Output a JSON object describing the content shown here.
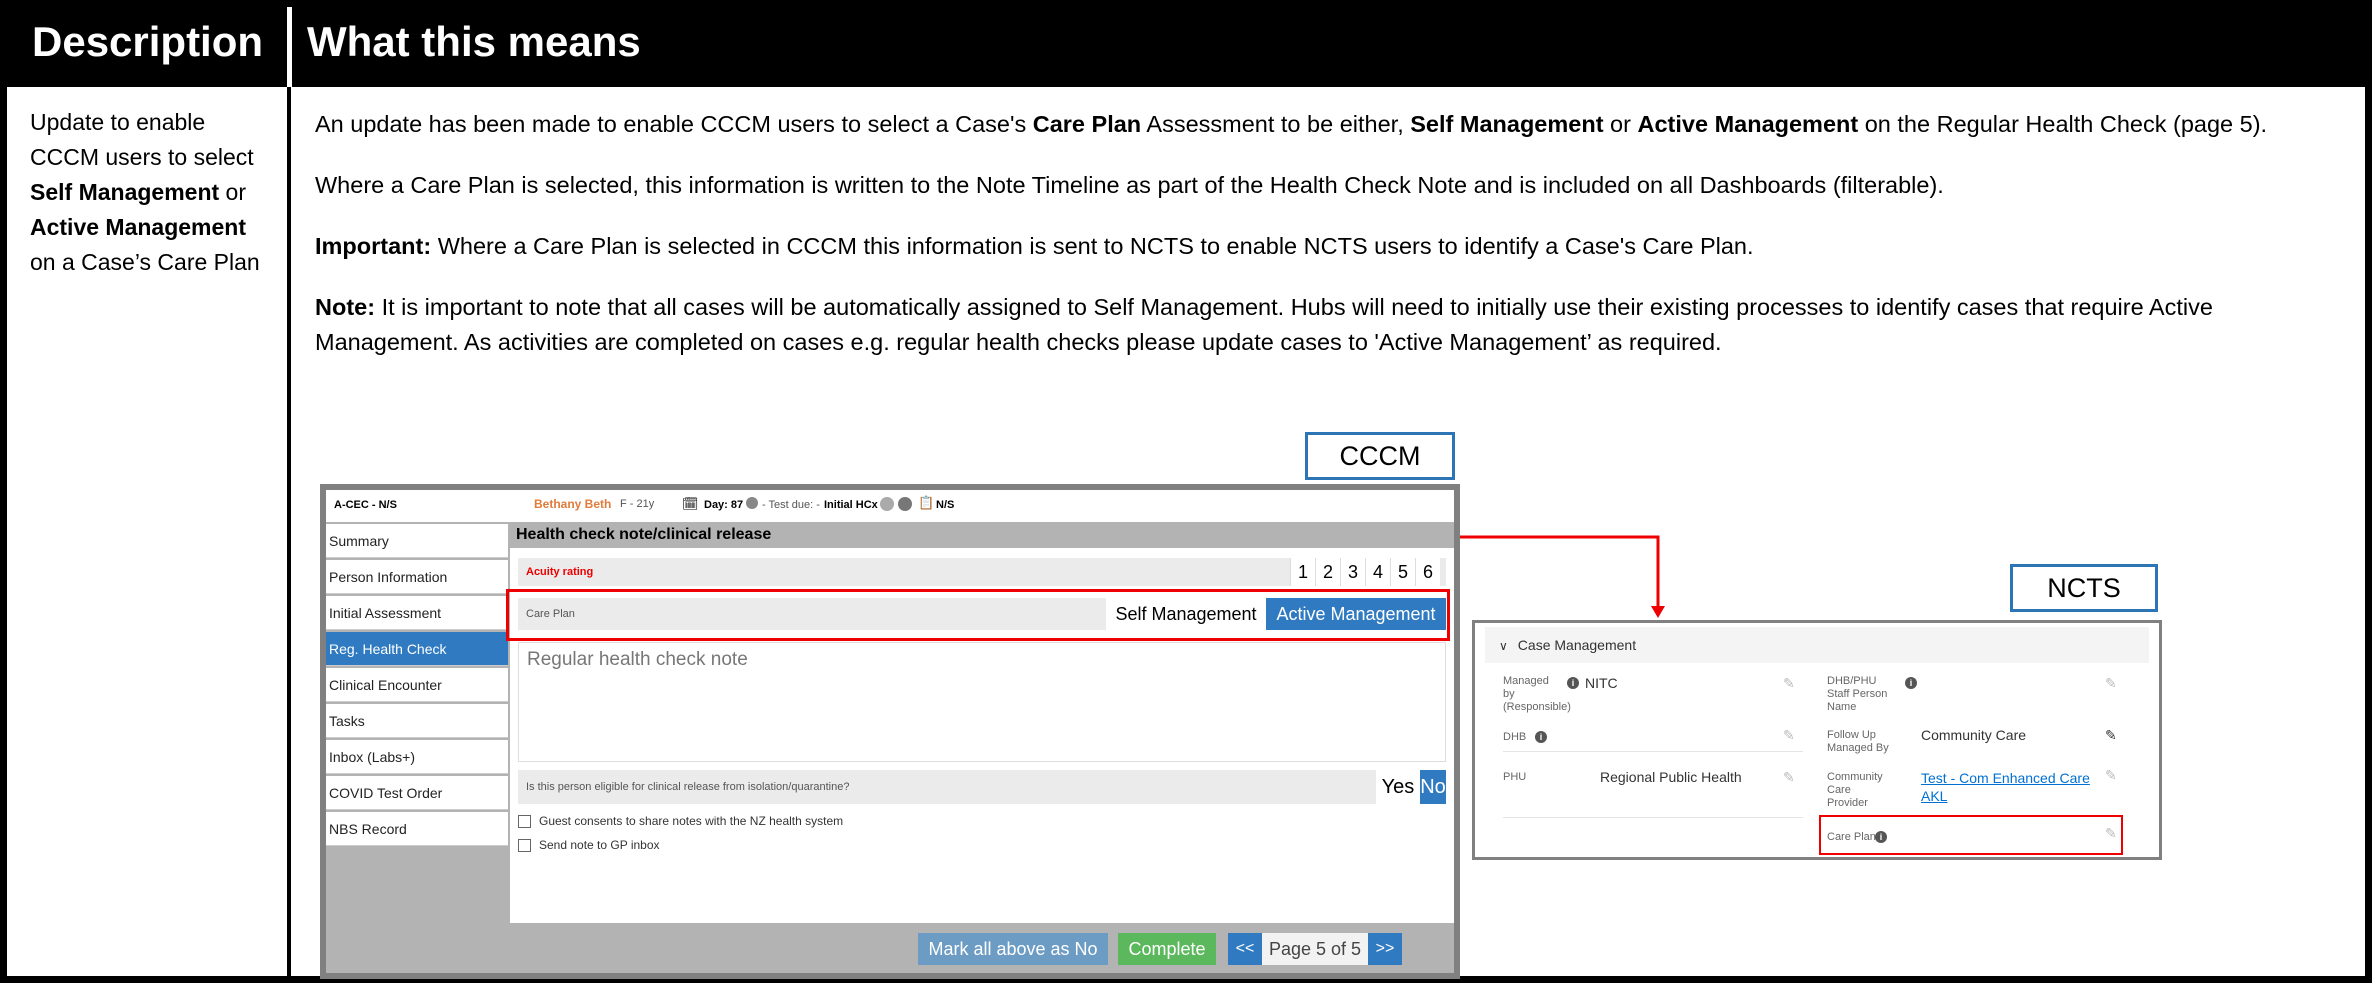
{
  "header": {
    "description": "Description",
    "meaning": "What this means"
  },
  "description_cell": {
    "p1": "Update to enable CCCM users to select ",
    "b1": "Self Management",
    "p2": " or ",
    "b2": "Active Management",
    "p3": " on a Case’s Care Plan"
  },
  "meaning": {
    "para1": {
      "t1": "An update has been made to enable CCCM users to select a Case's ",
      "b1": "Care Plan",
      "t2": " Assessment to be either, ",
      "b2": "Self Management",
      "t3": " or ",
      "b3": "Active Management",
      "t4": " on the Regular Health Check (page 5)."
    },
    "para2": "Where a Care Plan is selected, this information is written to the Note Timeline as part of the Health Check Note and is included on all Dashboards (filterable).",
    "para3": {
      "b": "Important:",
      "t": " Where a Care Plan is selected in CCCM this information is sent to NCTS to enable NCTS users to identify a Case's Care Plan."
    },
    "para4": {
      "b": "Note:",
      "t": " It is important to note that all cases will be automatically assigned to Self Management. Hubs will need to initially use their existing processes to identify cases that require Active Management. As activities are completed on cases e.g. regular health checks please update cases to 'Active Management’ as required."
    }
  },
  "labels": {
    "cccm": "CCCM",
    "ncts": "NCTS"
  },
  "cccm": {
    "case_id": "A-CEC - N/S",
    "patient_name": "Bethany Beth",
    "patient_meta": "F - 21y",
    "day": "Day: 87",
    "test_due": "- Test due: -",
    "initial_hcx": "Initial HCx",
    "ns": "N/S",
    "nav": [
      "Summary",
      "Person Information",
      "Initial Assessment",
      "Reg. Health Check",
      "Clinical Encounter",
      "Tasks",
      "Inbox (Labs+)",
      "COVID Test Order",
      "NBS Record"
    ],
    "active_nav": "Reg. Health Check",
    "section_title": "Health check note/clinical release",
    "acuity_label": "Acuity rating",
    "acuity_values": [
      "1",
      "2",
      "3",
      "4",
      "5",
      "6"
    ],
    "care_plan_label": "Care Plan",
    "self_mgmt": "Self Management",
    "active_mgmt": "Active Management",
    "note_placeholder": "Regular health check note",
    "eligibility_question": "Is this person eligible for clinical release from isolation/quarantine?",
    "yes": "Yes",
    "no": "No",
    "consent": "Guest consents to share notes with the NZ health system",
    "send_gp": "Send note to GP inbox",
    "mark_all": "Mark all above as No",
    "complete": "Complete",
    "prev": "<<",
    "page": "Page 5 of 5",
    "next": ">>",
    "colors": {
      "active": "#2f7ac0",
      "complete": "#5cb85c",
      "mark": "#6c9cc4",
      "highlight": "#e00000",
      "name": "#e07b39"
    }
  },
  "ncts": {
    "section": "Case Management",
    "managed_by_label": "Managed by (Responsible)",
    "managed_by_value": "NITC",
    "dhb_label": "DHB",
    "phu_label": "PHU",
    "phu_value": "Regional Public Health",
    "staff_label": "DHB/PHU Staff Person Name",
    "follow_label": "Follow Up Managed By",
    "follow_value": "Community Care",
    "provider_label": "Community Care Provider",
    "provider_value_1": "Test - Com Enhanced Care",
    "provider_value_2": "AKL",
    "care_plan_label": "Care Plan"
  }
}
